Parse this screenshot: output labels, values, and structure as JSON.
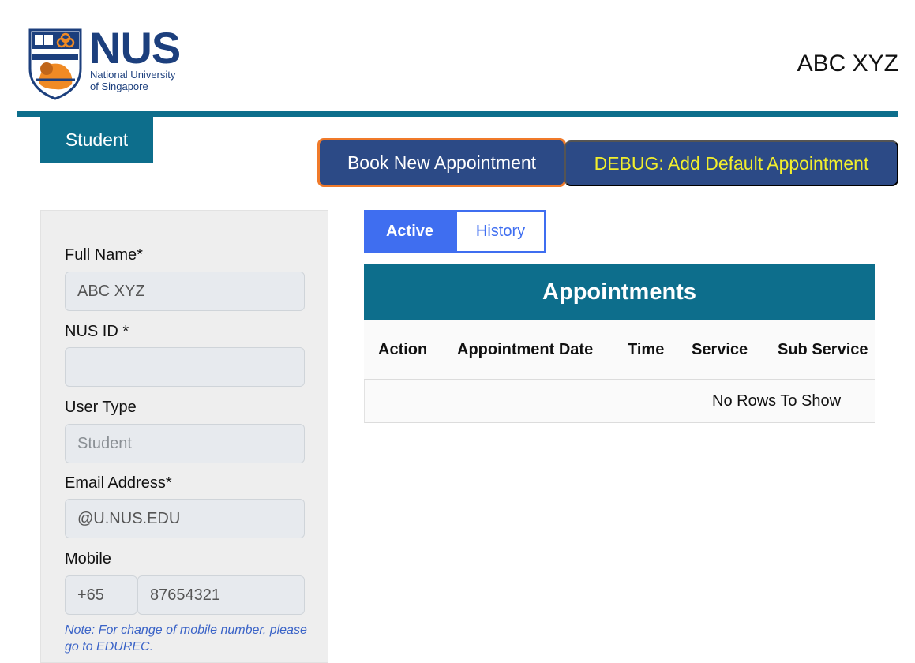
{
  "header": {
    "logo_name": "NUS",
    "logo_subtitle_line1": "National University",
    "logo_subtitle_line2": "of Singapore",
    "user_name": "ABC XYZ",
    "role_tab": "Student"
  },
  "actions": {
    "book_label": "Book New Appointment",
    "debug_label": "DEBUG: Add Default Appointment"
  },
  "profile": {
    "full_name_label": "Full Name*",
    "full_name_value": "ABC XYZ",
    "nus_id_label": "NUS ID *",
    "nus_id_value": "",
    "user_type_label": "User Type",
    "user_type_value": "Student",
    "email_label": "Email Address*",
    "email_value": "@U.NUS.EDU",
    "mobile_label": "Mobile",
    "mobile_country_code": "+65",
    "mobile_number": "87654321",
    "note": "Note: For change of mobile number, please go to EDUREC."
  },
  "tabs": [
    {
      "label": "Active",
      "selected": true
    },
    {
      "label": "History",
      "selected": false
    }
  ],
  "appointments": {
    "title": "Appointments",
    "columns": [
      "Action",
      "Appointment Date",
      "Time",
      "Service",
      "Sub Service"
    ],
    "empty_message": "No Rows To Show"
  },
  "colors": {
    "brand_teal": "#0d6e8c",
    "button_navy": "#2c4a86",
    "focus_orange": "#f07a2a",
    "debug_yellow": "#f2ee2c",
    "tab_blue": "#3f6ef0"
  },
  "icons": [
    "nus-crest-icon"
  ]
}
